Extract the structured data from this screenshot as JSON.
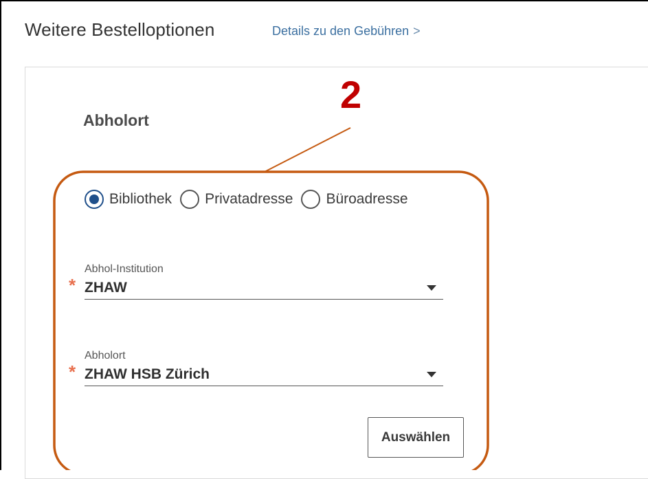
{
  "header": {
    "title": "Weitere Bestelloptionen",
    "fee_link": "Details zu den Gebühren",
    "fee_link_chevron": ">"
  },
  "section": {
    "title": "Abholort"
  },
  "callout": {
    "number": "2",
    "color": "#c00000",
    "outline_color": "#c55a11"
  },
  "delivery_options": [
    {
      "label": "Bibliothek",
      "selected": true
    },
    {
      "label": "Privatadresse",
      "selected": false
    },
    {
      "label": "Büroadresse",
      "selected": false
    }
  ],
  "fields": {
    "institution": {
      "label": "Abhol-Institution",
      "value": "ZHAW",
      "required_mark": "*"
    },
    "pickup_location": {
      "label": "Abholort",
      "value": "ZHAW HSB Zürich",
      "required_mark": "*"
    }
  },
  "actions": {
    "select_label": "Auswählen"
  },
  "colors": {
    "accent": "#1f4f8a",
    "link": "#3b6fa0",
    "required": "#e8704e"
  },
  "icons": {
    "dropdown": "chevron-down-icon",
    "radio_selected": "radio-selected-icon",
    "radio_unselected": "radio-unselected-icon"
  }
}
